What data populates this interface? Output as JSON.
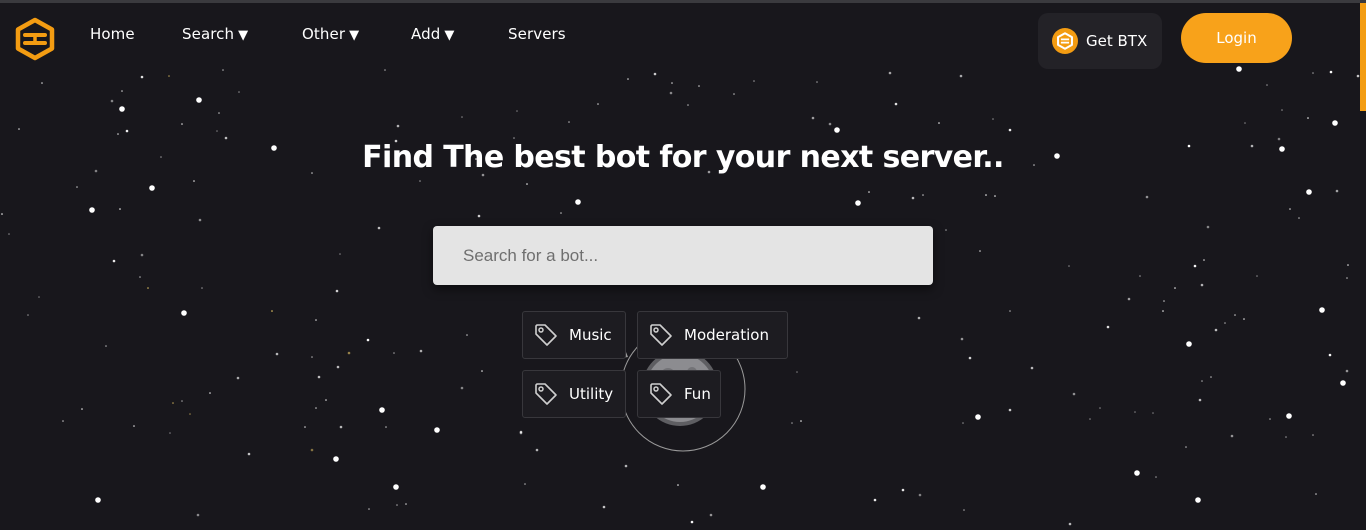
{
  "nav": {
    "brand_icon": "hexagon-logo-icon",
    "items": [
      {
        "label": "Home",
        "has_dropdown": false
      },
      {
        "label": "Search",
        "has_dropdown": true
      },
      {
        "label": "Other",
        "has_dropdown": true
      },
      {
        "label": "Add",
        "has_dropdown": true
      },
      {
        "label": "Servers",
        "has_dropdown": false
      }
    ],
    "caret": "▼",
    "btx_label": "Get BTX",
    "login_label": "Login"
  },
  "hero": {
    "title": "Find The best bot for your next server..",
    "search_placeholder": "Search for a bot..."
  },
  "tags": [
    {
      "label": "Music",
      "icon": "tag-icon"
    },
    {
      "label": "Moderation",
      "icon": "tag-icon"
    },
    {
      "label": "Utility",
      "icon": "tag-icon"
    },
    {
      "label": "Fun",
      "icon": "tag-icon"
    }
  ],
  "colors": {
    "background": "#18171c",
    "accent": "#f8a21a",
    "panel": "#232227",
    "tag_bg": "#1d1c21",
    "search_bg": "#e4e4e4"
  }
}
